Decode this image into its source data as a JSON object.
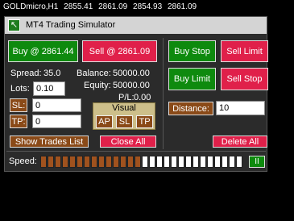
{
  "ticker": {
    "symbol": "GOLDmicro,H1",
    "open": "2855.41",
    "high": "2861.09",
    "low": "2854.93",
    "close": "2861.09"
  },
  "window": {
    "title": "MT4 Trading Simulator",
    "icon": "arrow-up-left-icon"
  },
  "trade": {
    "buy_label": "Buy @ 2861.44",
    "sell_label": "Sell @ 2861.09",
    "spread_label": "Spread:",
    "spread_value": "35.0",
    "lots_label": "Lots:",
    "lots_value": "0.10",
    "sl_label": "SL:",
    "sl_value": "0",
    "tp_label": "TP:",
    "tp_value": "0"
  },
  "account": {
    "balance_label": "Balance:",
    "balance_value": "50000.00",
    "equity_label": "Equity:",
    "equity_value": "50000.00",
    "pl_label": "P/L:",
    "pl_value": "0.00"
  },
  "visual": {
    "title": "Visual",
    "ap": "AP",
    "sl": "SL",
    "tp": "TP"
  },
  "pending": {
    "buy_stop": "Buy Stop",
    "sell_limit": "Sell Limit",
    "buy_limit": "Buy Limit",
    "sell_stop": "Sell Stop",
    "distance_label": "Distance:",
    "distance_value": "10"
  },
  "actions": {
    "show_trades": "Show Trades List",
    "close_all": "Close All",
    "delete_all": "Delete All"
  },
  "speed": {
    "label": "Speed:",
    "level": 0.5,
    "segments": 28,
    "pause_label": "II"
  },
  "colors": {
    "buy": "#0e8a0e",
    "sell": "#e0204a",
    "tag": "#8a4a18",
    "speed_on": "#a0521e"
  }
}
